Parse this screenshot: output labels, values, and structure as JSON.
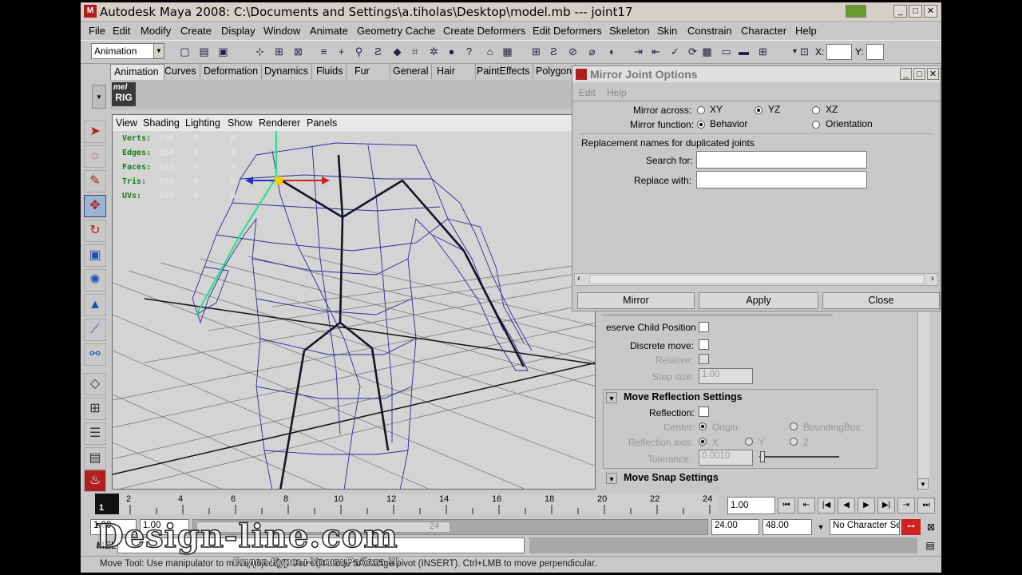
{
  "window": {
    "title": "Autodesk Maya 2008: C:\\Documents and Settings\\a.tiholas\\Desktop\\model.mb  ---  joint17",
    "controls": [
      "_",
      "□",
      "✕"
    ]
  },
  "menubar": [
    "File",
    "Edit",
    "Modify",
    "Create",
    "Display",
    "Window",
    "Animate",
    "Geometry Cache",
    "Create Deformers",
    "Edit Deformers",
    "Skeleton",
    "Skin",
    "Constrain",
    "Character",
    "Help"
  ],
  "toolbar": {
    "module": "Animation",
    "x_label": "X:",
    "y_label": "Y:"
  },
  "shelf_tabs": [
    "Animation",
    "Curves",
    "Deformation",
    "Dynamics",
    "Fluids",
    "Fur",
    "General",
    "Hair",
    "PaintEffects",
    "Polygon"
  ],
  "shelf": {
    "mel_label": "mel",
    "rig_label": "RIG"
  },
  "viewport": {
    "menu": [
      "View",
      "Shading",
      "Lighting",
      "Show",
      "Renderer",
      "Panels"
    ],
    "hud": [
      {
        "label": "Verts:",
        "values": [
          "144",
          "0",
          "0"
        ]
      },
      {
        "label": "Edges:",
        "values": [
          "284",
          "0",
          "0"
        ]
      },
      {
        "label": "Faces:",
        "values": [
          "142",
          "0",
          "0"
        ]
      },
      {
        "label": "Tris:",
        "values": [
          "284",
          "0",
          "0"
        ]
      },
      {
        "label": "UVs:",
        "values": [
          "168",
          "0",
          "0"
        ]
      }
    ]
  },
  "dialog": {
    "title": "Mirror Joint Options",
    "menu": [
      "Edit",
      "Help"
    ],
    "mirror_across_label": "Mirror across:",
    "mirror_across_options": [
      "XY",
      "YZ",
      "XZ"
    ],
    "mirror_function_label": "Mirror function:",
    "mirror_function_options": [
      "Behavior",
      "Orientation"
    ],
    "replacement_header": "Replacement names for duplicated joints",
    "search_label": "Search for:",
    "replace_label": "Replace with:",
    "search_value": "",
    "replace_value": "",
    "buttons": [
      "Mirror",
      "Apply",
      "Close"
    ]
  },
  "attr_panel": {
    "preserve_child": "eserve Child Position",
    "discrete_move": "Discrete move:",
    "relative": "Relative:",
    "step_size_label": "Step size:",
    "step_size_value": "1.00",
    "reflection_section": "Move Reflection Settings",
    "reflection_label": "Reflection:",
    "center_label": "Center:",
    "center_options": [
      "Origin",
      "BoundingBox"
    ],
    "axis_label": "Reflection axis:",
    "axis_options": [
      "X",
      "Y",
      "Z"
    ],
    "tolerance_label": "Tolerance:",
    "tolerance_value": "0.0010",
    "snap_section": "Move Snap Settings"
  },
  "timeline": {
    "current_frame": "1",
    "ticks": [
      "2",
      "4",
      "6",
      "8",
      "10",
      "12",
      "14",
      "16",
      "18",
      "20",
      "22",
      "24"
    ],
    "current_field": "1.00"
  },
  "range": {
    "start": "1.00",
    "anim_start": "1.00",
    "slider_end_label": "24",
    "end": "24.00",
    "anim_end": "48.00",
    "character": "No Character Se"
  },
  "command": {
    "label": "MEL"
  },
  "help_line": "Move Tool: Use manipulator to move object(s). Use edit mode to change pivot (INSERT). Ctrl+LMB to move perpendicular.",
  "watermark": {
    "site": "Design-line.com",
    "subtitle": "Видео Курсы-Уроки,Работа !!!"
  }
}
